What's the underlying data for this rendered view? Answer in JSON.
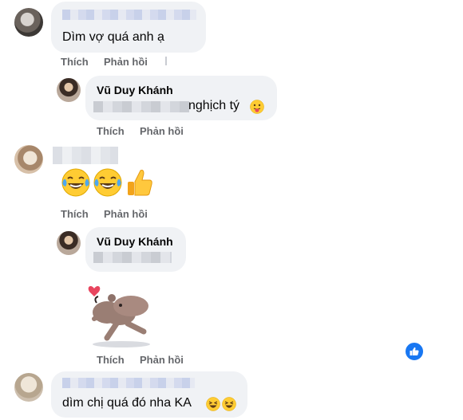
{
  "comments": [
    {
      "text": "Dìm vợ quá anh ạ",
      "actions": {
        "like": "Thích",
        "reply": "Phản hồi"
      }
    },
    {
      "reply_author": "Vũ Duy Khánh",
      "text": "nghịch tý",
      "actions": {
        "like": "Thích",
        "reply": "Phản hồi"
      }
    },
    {
      "emojis": [
        "face-with-tears-of-joy",
        "face-with-tears-of-joy",
        "thumbs-up"
      ],
      "actions": {
        "like": "Thích",
        "reply": "Phản hồi"
      }
    },
    {
      "reply_author": "Vũ Duy Khánh",
      "sticker": "dancing-capybara-with-heart",
      "actions": {
        "like": "Thích",
        "reply": "Phản hồi"
      },
      "reaction": "like"
    },
    {
      "text": "dìm chị quá đó nha KA"
    }
  ],
  "colors": {
    "bubble": "#f0f2f5",
    "action_text": "#65676b",
    "like_blue": "#1877f2"
  }
}
